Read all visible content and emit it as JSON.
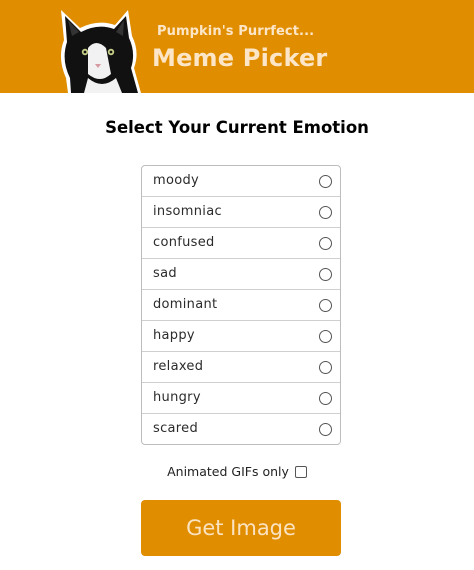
{
  "header": {
    "subtitle": "Pumpkin's Purrfect...",
    "title": "Meme Picker",
    "logo_icon": "cat-photo-icon",
    "background_color": "#e08e00",
    "text_color": "#fde6c8"
  },
  "main": {
    "heading": "Select Your Current Emotion",
    "emotions": [
      {
        "label": "moody",
        "selected": false
      },
      {
        "label": "insomniac",
        "selected": false
      },
      {
        "label": "confused",
        "selected": false
      },
      {
        "label": "sad",
        "selected": false
      },
      {
        "label": "dominant",
        "selected": false
      },
      {
        "label": "happy",
        "selected": false
      },
      {
        "label": "relaxed",
        "selected": false
      },
      {
        "label": "hungry",
        "selected": false
      },
      {
        "label": "scared",
        "selected": false
      }
    ],
    "gif_option": {
      "label": "Animated GIFs only",
      "checked": false
    },
    "submit_label": "Get Image",
    "accent_color": "#e08e00"
  }
}
